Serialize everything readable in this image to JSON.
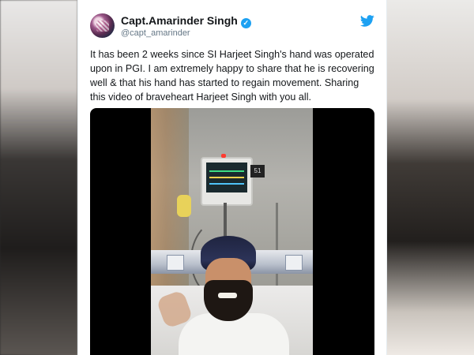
{
  "tweet": {
    "author_name": "Capt.Amarinder Singh",
    "handle": "@capt_amarinder",
    "verified_glyph": "✓",
    "text": "It has been 2 weeks since SI Harjeet Singh's hand was operated upon in PGI. I am extremely happy to share that he is recovering well & that his hand has started to regain movement. Sharing this video of braveheart Harjeet Singh with you all.",
    "avatar_icon": "profile-avatar",
    "brand_icon": "twitter-bird-icon"
  },
  "video": {
    "monitor_badge": "51"
  },
  "colors": {
    "brand": "#1da1f2",
    "text_primary": "#14171a",
    "text_secondary": "#657786"
  }
}
